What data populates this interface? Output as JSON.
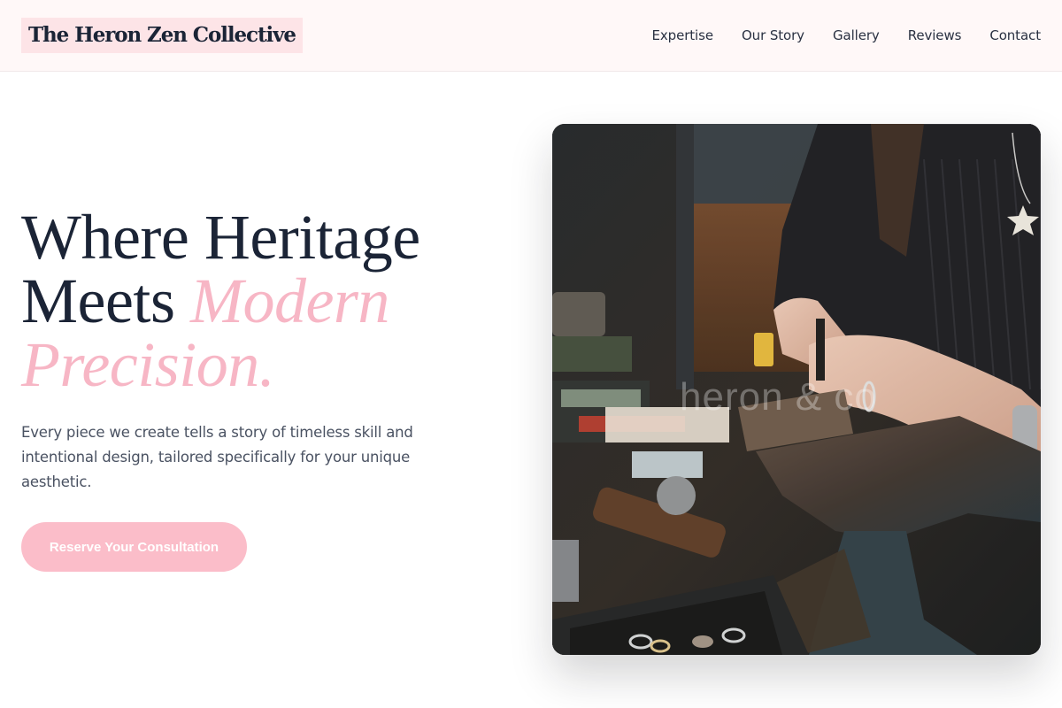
{
  "header": {
    "brand": "The Heron Zen Collective",
    "nav": [
      "Expertise",
      "Our Story",
      "Gallery",
      "Reviews",
      "Contact"
    ]
  },
  "hero": {
    "title_line1": "Where Heritage",
    "title_line2_plain": "Meets ",
    "title_line2_accent": "Modern",
    "title_line3_accent": "Precision.",
    "description": "Every piece we create tells a story of timeless skill and intentional design, tailored specifically for your unique aesthetic.",
    "cta_label": "Reserve Your Consultation",
    "image_watermark": "heron & co"
  },
  "colors": {
    "accent_pink": "#f7b6c5",
    "button_pink": "#fbbdc9",
    "brand_bg": "#fde4e7",
    "header_bg": "#fff8f8",
    "ink": "#1b2436"
  }
}
